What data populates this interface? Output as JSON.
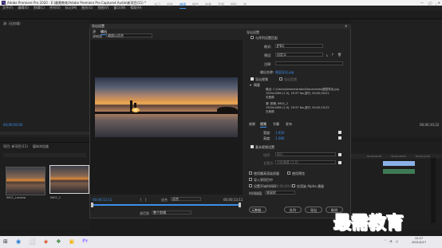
{
  "window": {
    "title": "Adobe Premiere Pro 2020 - E:\\最需教育\\Adobe Premiere Pro Captured Audio\\新项目(11) *",
    "controls": [
      "—",
      "▢",
      "✕"
    ]
  },
  "menu": [
    "文件(F)",
    "编辑(E)",
    "剪辑(C)",
    "序列(S)",
    "标记(M)",
    "图形(G)",
    "视图(V)",
    "窗口(W)",
    "帮助(H)"
  ],
  "workspace_tabs": [
    {
      "label": "学习",
      "active": false
    },
    {
      "label": "组件",
      "active": false
    },
    {
      "label": "编辑",
      "active": true
    },
    {
      "label": "颜色",
      "active": false
    },
    {
      "label": "效果",
      "active": false
    },
    {
      "label": "音频",
      "active": false
    },
    {
      "label": "图形",
      "active": false
    },
    {
      "label": "库",
      "active": false
    }
  ],
  "source": {
    "tab": "源: (无剪辑)",
    "timecode": "00;00;00;00"
  },
  "project": {
    "tabs": [
      "项目: 新项目(11)",
      "媒体浏览器"
    ],
    "clips": [
      {
        "name": "IMG1_Lreview"
      },
      {
        "name": "IMG1_2"
      }
    ]
  },
  "program": {
    "timecode_right": "00;00;10;22"
  },
  "timeline": {
    "ruler": [
      "00;00;04;00",
      "00;00;08;00",
      "00;00;12;00"
    ]
  },
  "dialog": {
    "title": "导出设置",
    "close": "✕",
    "tabs": [
      {
        "label": "源",
        "active": false
      },
      {
        "label": "输出",
        "active": true
      }
    ],
    "source_scaling_label": "源缩放",
    "source_scaling_value": "缩放以适合",
    "preview": {
      "timecode_start": "00;00;13;11",
      "timecode_end": "00;00;13;11",
      "fit_label": "适合",
      "fit_value": "适合",
      "range_label": "源范围",
      "range_value": "整个剪辑",
      "marker_icons": [
        "{",
        "}"
      ]
    },
    "export_settings": {
      "header": "导出设置",
      "match_sequence": "与序列设置匹配",
      "format_label": "格式:",
      "format_value": "JPEG",
      "preset_label": "预设:",
      "preset_value": "自定义",
      "comments_label": "注释:",
      "output_name_label": "输出名称:",
      "output_name_value": "图层导出.jpg",
      "export_video": "导出视频",
      "export_audio": "导出音频",
      "summary_label": "摘要",
      "summary_output": "输出: C:\\Users\\Administrator\\Documents\\图层导出.jpg",
      "summary_output_detail": "1920x1080 (1.0), 29.97 fps,逐行, 00;00;00;01",
      "summary_output_extra": "无音频",
      "summary_source": "源: 剪辑, IMG1_2",
      "summary_source_detail": "1920x1080 (1.0), 29.97 fps,逐行, 00;00;10;22",
      "summary_source_extra": "无音频"
    },
    "subtabs": [
      {
        "label": "效果",
        "active": false
      },
      {
        "label": "视频",
        "active": true
      },
      {
        "label": "字幕",
        "active": false
      },
      {
        "label": "发布",
        "active": false
      }
    ],
    "video": {
      "width_label": "宽度:",
      "width_value": "1,920",
      "height_label": "高度:",
      "height_value": "1,080",
      "render_alpha": "渲染 Alpha 通道",
      "basic_settings": "基本视频设置",
      "field_order_label": "场序:",
      "field_order_value": "逐行",
      "aspect_label": "长宽比:",
      "aspect_value": "方形像素 (1.0)"
    },
    "options": {
      "max_render": "使用最高渲染质量",
      "use_previews": "使用预览",
      "import_project": "导入到项目中",
      "set_start_tc": "设置开始时间码",
      "start_tc_value": "00;00;00;00",
      "render_alpha_only": "仅渲染 Alpha 通道",
      "interp_label": "时间插值:",
      "interp_value": "帧采样"
    },
    "buttons": {
      "metadata": "元数据...",
      "queue": "队列",
      "export": "导出",
      "cancel": "取消"
    }
  },
  "watermark": "最需教育",
  "taskbar": {
    "start_icon": "windows-logo",
    "apps": [
      "⊞",
      "◉",
      "⬜",
      "◈",
      "❖",
      "▣",
      "Pr"
    ],
    "clock_time": "12:17",
    "clock_date": "2021/5/17"
  }
}
